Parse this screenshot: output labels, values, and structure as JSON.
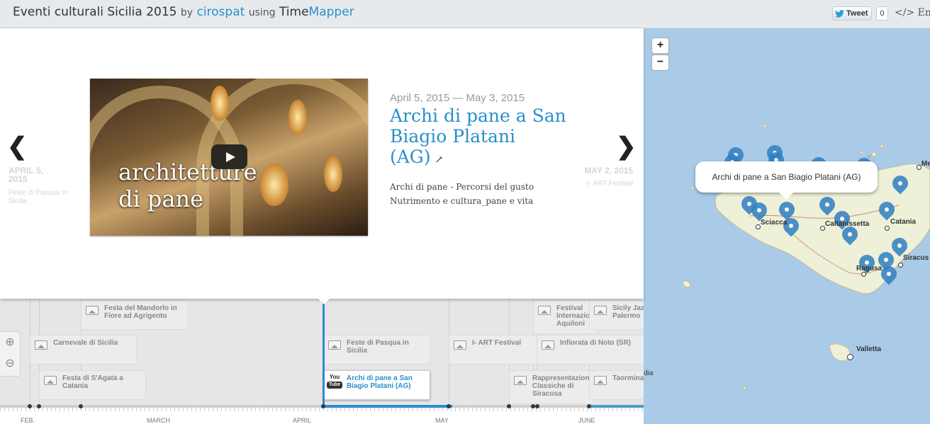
{
  "header": {
    "title": "Eventi culturali Sicilia 2015",
    "by": "by",
    "author": "cirospat",
    "using": "using",
    "app_part1": "Time",
    "app_part2": "Mapper",
    "tweet_label": "Tweet",
    "tweet_count": "0",
    "embed_label": "</> Emb"
  },
  "slide": {
    "date_range": "April 5, 2015 — May 3, 2015",
    "headline": "Archi di pane a San Biagio Platani (AG)",
    "description_line1": "Archi di pane - Percorsi del gusto",
    "description_line2": "Nutrimento e cultura_pane e vita",
    "video_text_line1": "architetture",
    "video_text_line2": "di pane",
    "prev_date": "APRIL 5, 2015",
    "prev_title": "Feste di Pasqua in Sicilia",
    "next_date": "MAY 2, 2015",
    "next_title": "I- ART Festival",
    "prev_arrow": "❮",
    "next_arrow": "❯"
  },
  "timeline": {
    "zoom_in": "⊕",
    "zoom_out": "⊖",
    "events": {
      "mandorlo": "Festa del Mandorlo in Fiore ad Agrigento",
      "carnevale": "Carnevale di Sicilia",
      "agata": "Festa di S'Agata a Catania",
      "pasqua": "Feste di Pasqua in Sicilia",
      "archi": "Archi di pane a San Biagio Platani (AG)",
      "iart": "I- ART Festival",
      "festival_intern": "Festival Internazionale Aquiloni",
      "sicily_jazz": "Sicily Jazz Palermo",
      "infiorata": "Infiorata di Noto (SR)",
      "rappresentazioni": "Rappresentazioni Classiche di Siracusa",
      "taormina": "Taormina"
    },
    "youtube_label": "You",
    "youtube_tube": "Tube",
    "axis_labels": {
      "feb": "FEB.",
      "mar": "MARCH",
      "apr": "APRIL",
      "may": "MAY",
      "jun": "JUNE"
    }
  },
  "map": {
    "zoom_in": "+",
    "zoom_out": "−",
    "popup_text": "Archi di pane a San Biagio Platani (AG)",
    "popup_close": "×",
    "cities": {
      "sciacca": "Sciacca",
      "caltanissetta": "Caltanissetta",
      "catania": "Catania",
      "siracusa": "Siracus",
      "ragusa": "Ragusa",
      "valletta": "Valletta",
      "messina": "Me",
      "libya": "dia"
    }
  },
  "colors": {
    "accent": "#2a8fc9",
    "sea": "#a9cbe8",
    "land": "#eef0d8",
    "pin": "#2f80c2"
  }
}
